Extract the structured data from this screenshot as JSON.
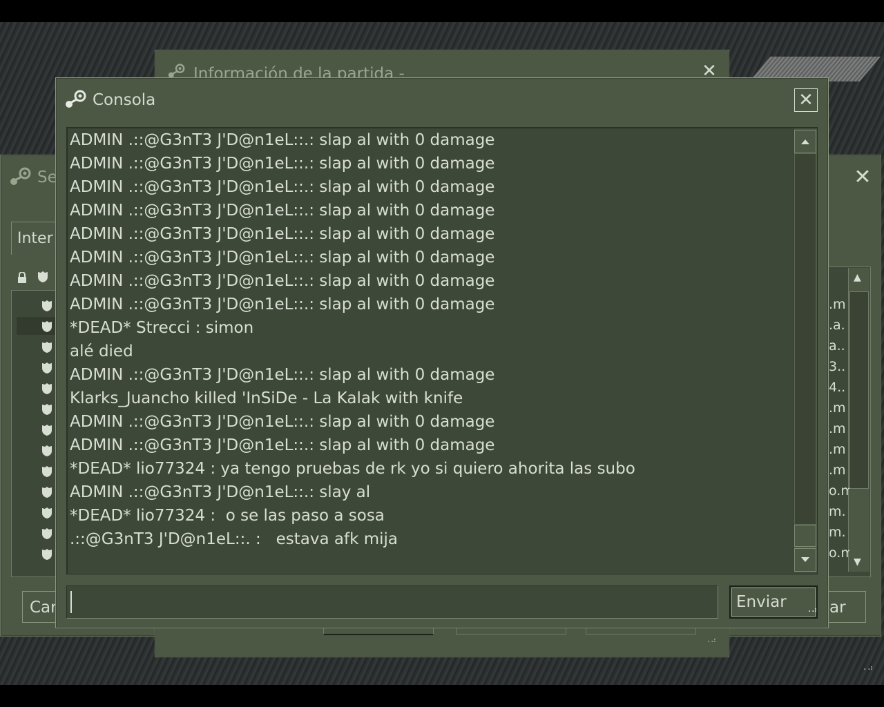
{
  "console": {
    "title": "Consola",
    "lines": [
      "ADMIN .::@G3nT3 J'D@n1eL::.: slap al with 0 damage",
      "ADMIN .::@G3nT3 J'D@n1eL::.: slap al with 0 damage",
      "ADMIN .::@G3nT3 J'D@n1eL::.: slap al with 0 damage",
      "ADMIN .::@G3nT3 J'D@n1eL::.: slap al with 0 damage",
      "ADMIN .::@G3nT3 J'D@n1eL::.: slap al with 0 damage",
      "ADMIN .::@G3nT3 J'D@n1eL::.: slap al with 0 damage",
      "ADMIN .::@G3nT3 J'D@n1eL::.: slap al with 0 damage",
      "ADMIN .::@G3nT3 J'D@n1eL::.: slap al with 0 damage",
      "*DEAD* Strecci : simon",
      "alé died",
      "ADMIN .::@G3nT3 J'D@n1eL::.: slap al with 0 damage",
      "Klarks_Juancho killed 'InSiDe - La Kalak with knife",
      "ADMIN .::@G3nT3 J'D@n1eL::.: slap al with 0 damage",
      "ADMIN .::@G3nT3 J'D@n1eL::.: slap al with 0 damage",
      "*DEAD* lio77324 : ya tengo pruebas de rk yo si quiero ahorita las subo",
      "ADMIN .::@G3nT3 J'D@n1eL::.: slay al",
      "*DEAD* lio77324 :  o se las paso a sosa",
      ".::@G3nT3 J'D@n1eL::. :   estava afk mija"
    ],
    "input_value": "",
    "send_label": "Enviar"
  },
  "info_window": {
    "title": "Información de la partida -"
  },
  "servers_window": {
    "title": "Se",
    "tab_label": "Inter",
    "left_button": "Car",
    "right_button": "ar",
    "right_column": [
      ".m",
      ".a.",
      "a..",
      "3..",
      "4..",
      ".m",
      ".m",
      ".m",
      ".m",
      "o.m",
      "m.",
      "m.",
      "o.m"
    ]
  },
  "icons": {
    "close": "close-icon",
    "steam": "steam-icon",
    "lock": "lock-icon",
    "shield": "shield-icon"
  },
  "colors": {
    "window_bg": "#4c5844",
    "panel_bg": "#3e4838",
    "text": "#d8ded3"
  }
}
